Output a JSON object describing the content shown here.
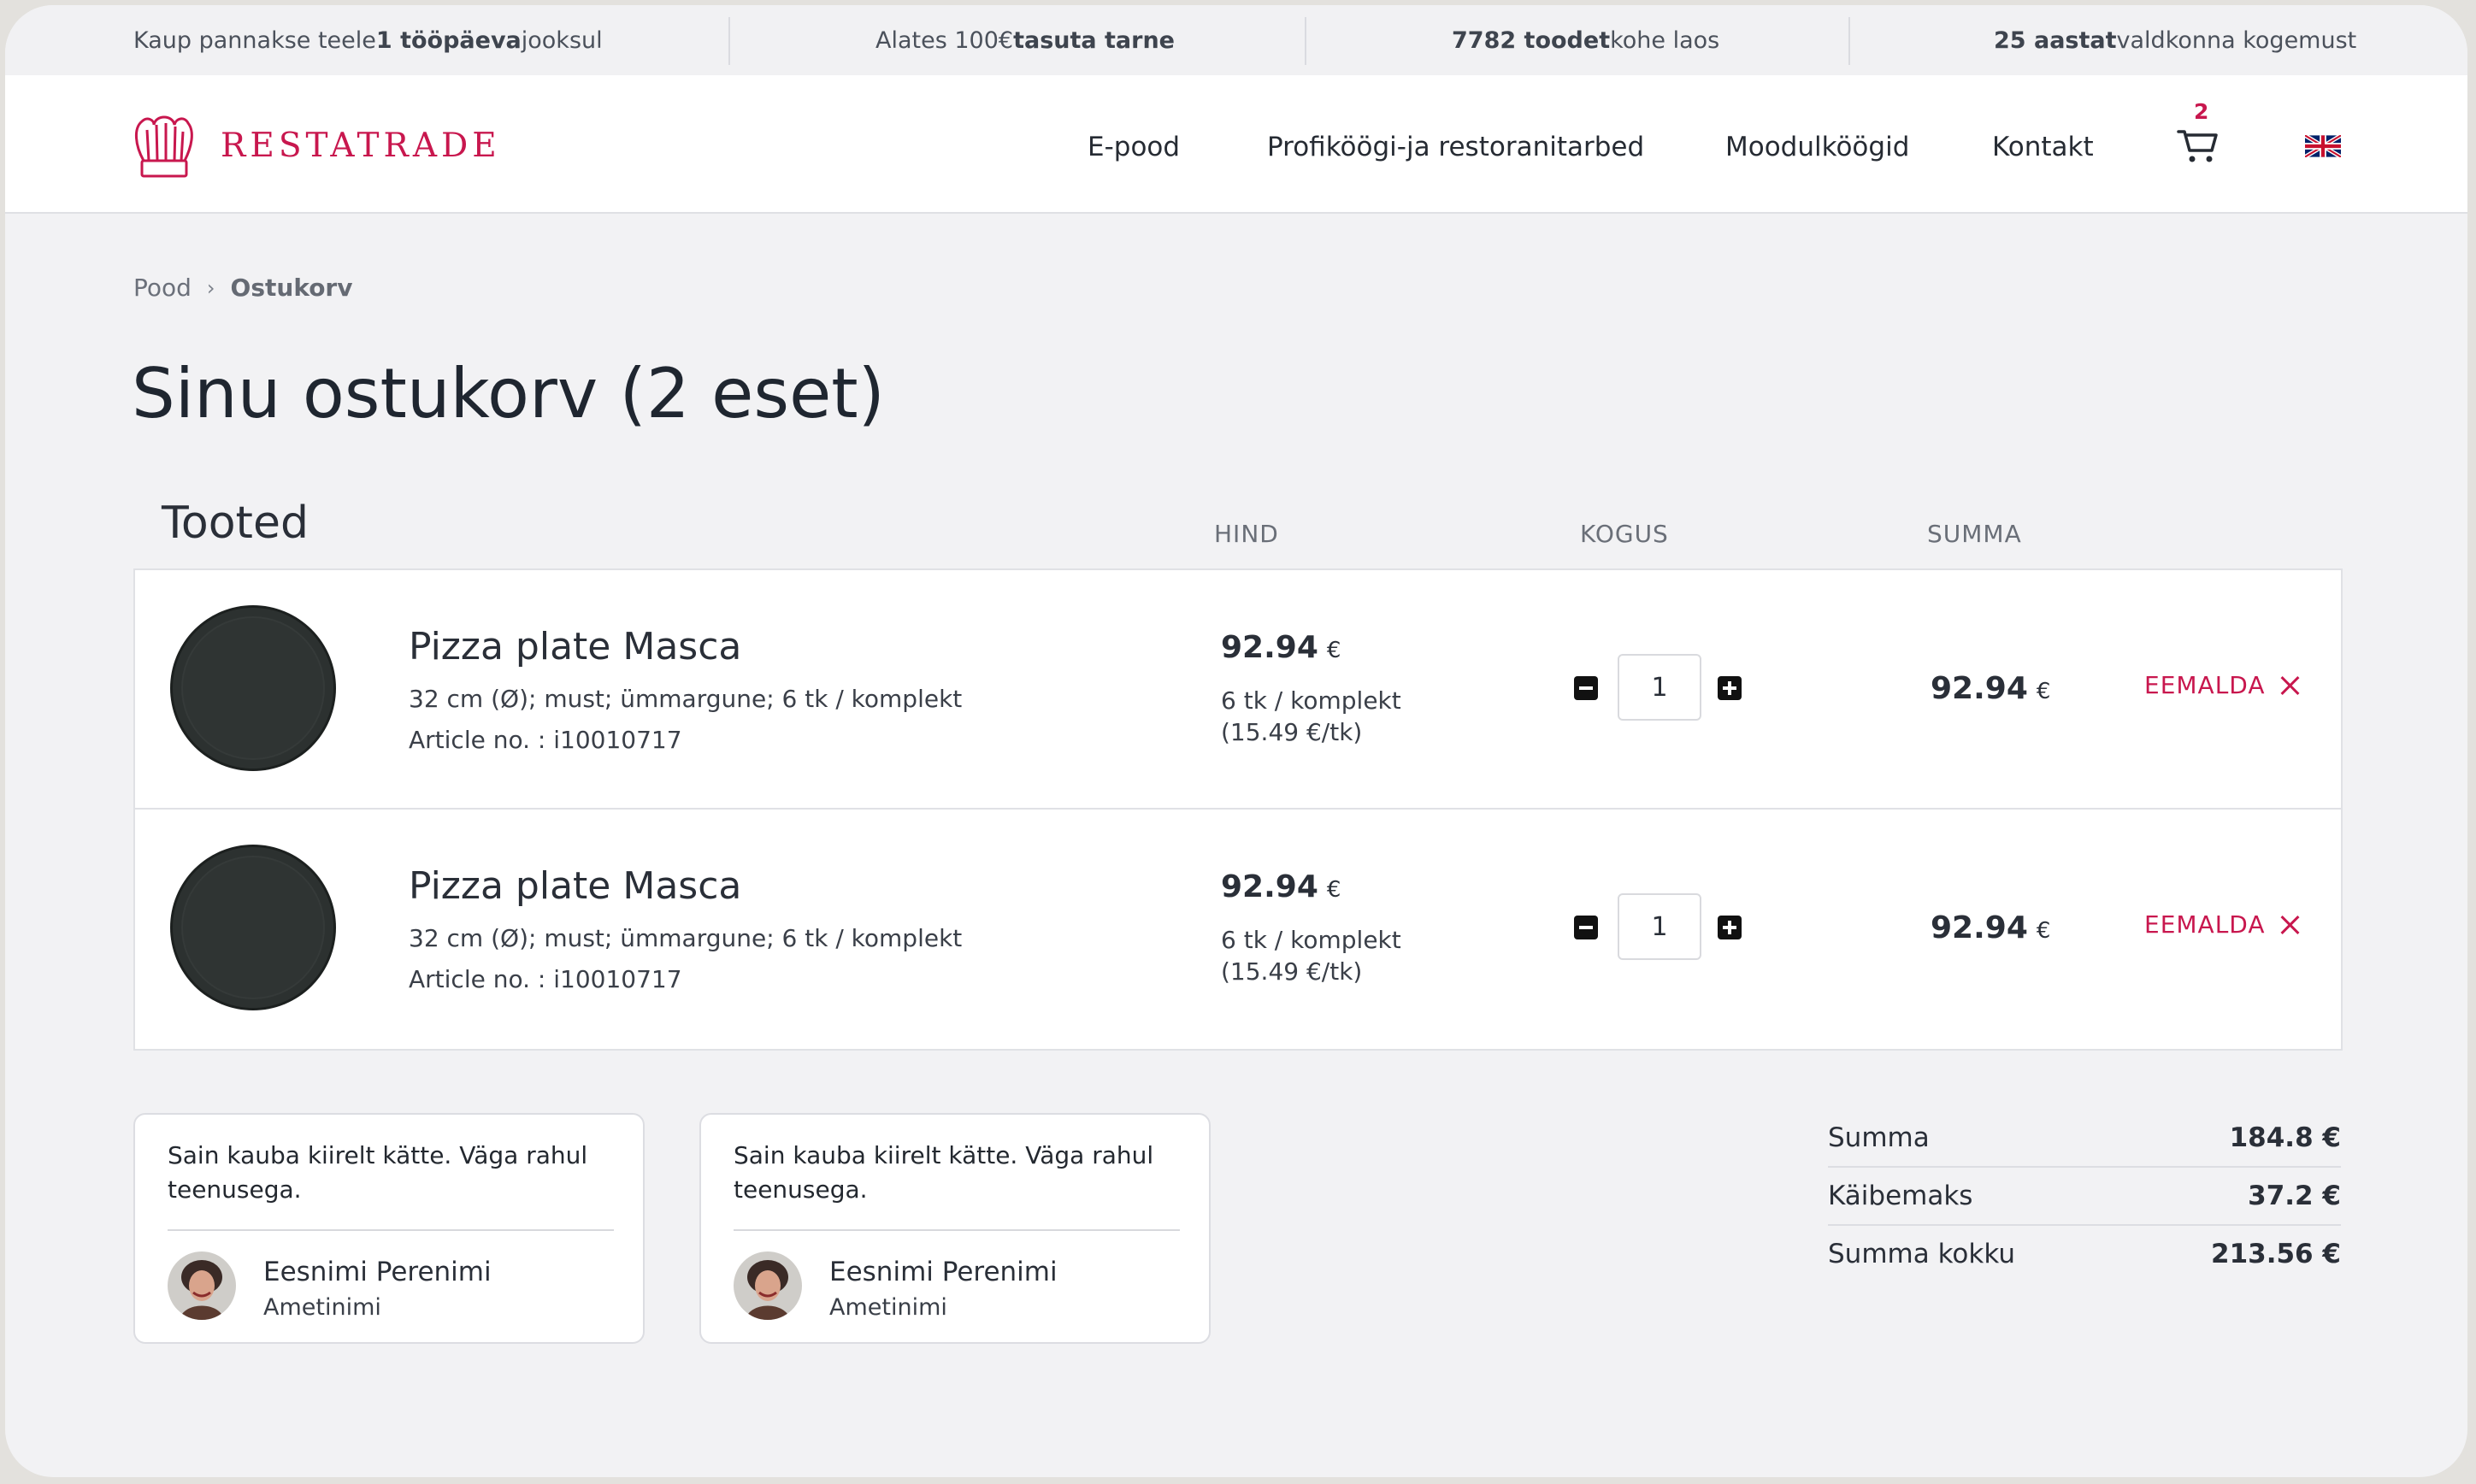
{
  "infobar": {
    "item1": {
      "pre": "Kaup pannakse teele ",
      "bold": "1 tööpäeva",
      "post": " jooksul"
    },
    "item2": {
      "pre": "Alates 100€ ",
      "bold": "tasuta tarne",
      "post": ""
    },
    "item3": {
      "pre": "",
      "bold": "7782 toodet",
      "post": " kohe laos"
    },
    "item4": {
      "pre": "",
      "bold": "25 aastat",
      "post": " valdkonna kogemust"
    }
  },
  "header": {
    "logo_text": "RESTATRADE",
    "nav": [
      "E-pood",
      "Profiköögi-ja restoranitarbed",
      "Moodulköögid",
      "Kontakt"
    ],
    "cart_count": "2",
    "language_icon": "uk-flag-icon"
  },
  "breadcrumb": {
    "items": [
      "Pood",
      "Ostukorv"
    ],
    "separator": "›"
  },
  "page_title": "Sinu ostukorv (2 eset)",
  "table": {
    "products_heading": "Tooted",
    "col_price": "HIND",
    "col_qty": "KOGUS",
    "col_sum": "SUMMA",
    "rows": [
      {
        "name": "Pizza plate Masca",
        "description": "32 cm (Ø); must; ümmargune; 6 tk / komplekt",
        "article": "Article no. : i10010717",
        "price": "92.94",
        "currency": "€",
        "pack": "6 tk / komplekt",
        "unit_price": "(15.49 €/tk)",
        "quantity": "1",
        "sum": "92.94",
        "remove_label": "EEMALDA"
      },
      {
        "name": "Pizza plate Masca",
        "description": "32 cm (Ø); must; ümmargune; 6 tk / komplekt",
        "article": "Article no. : i10010717",
        "price": "92.94",
        "currency": "€",
        "pack": "6 tk / komplekt",
        "unit_price": "(15.49 €/tk)",
        "quantity": "1",
        "sum": "92.94",
        "remove_label": "EEMALDA"
      }
    ]
  },
  "testimonials": [
    {
      "quote": "Sain kauba kiirelt kätte. Väga rahul teenusega.",
      "name": "Eesnimi Perenimi",
      "role": "Ametinimi"
    },
    {
      "quote": "Sain kauba kiirelt kätte. Väga rahul teenusega.",
      "name": "Eesnimi Perenimi",
      "role": "Ametinimi"
    }
  ],
  "totals": [
    {
      "label": "Summa",
      "value": "184.8 €"
    },
    {
      "label": "Käibemaks",
      "value": "37.2 €"
    },
    {
      "label": "Summa kokku",
      "value": "213.56 €"
    }
  ],
  "colors": {
    "brand": "#c8174e",
    "background": "#f2f2f4",
    "text": "#2a2f38"
  }
}
